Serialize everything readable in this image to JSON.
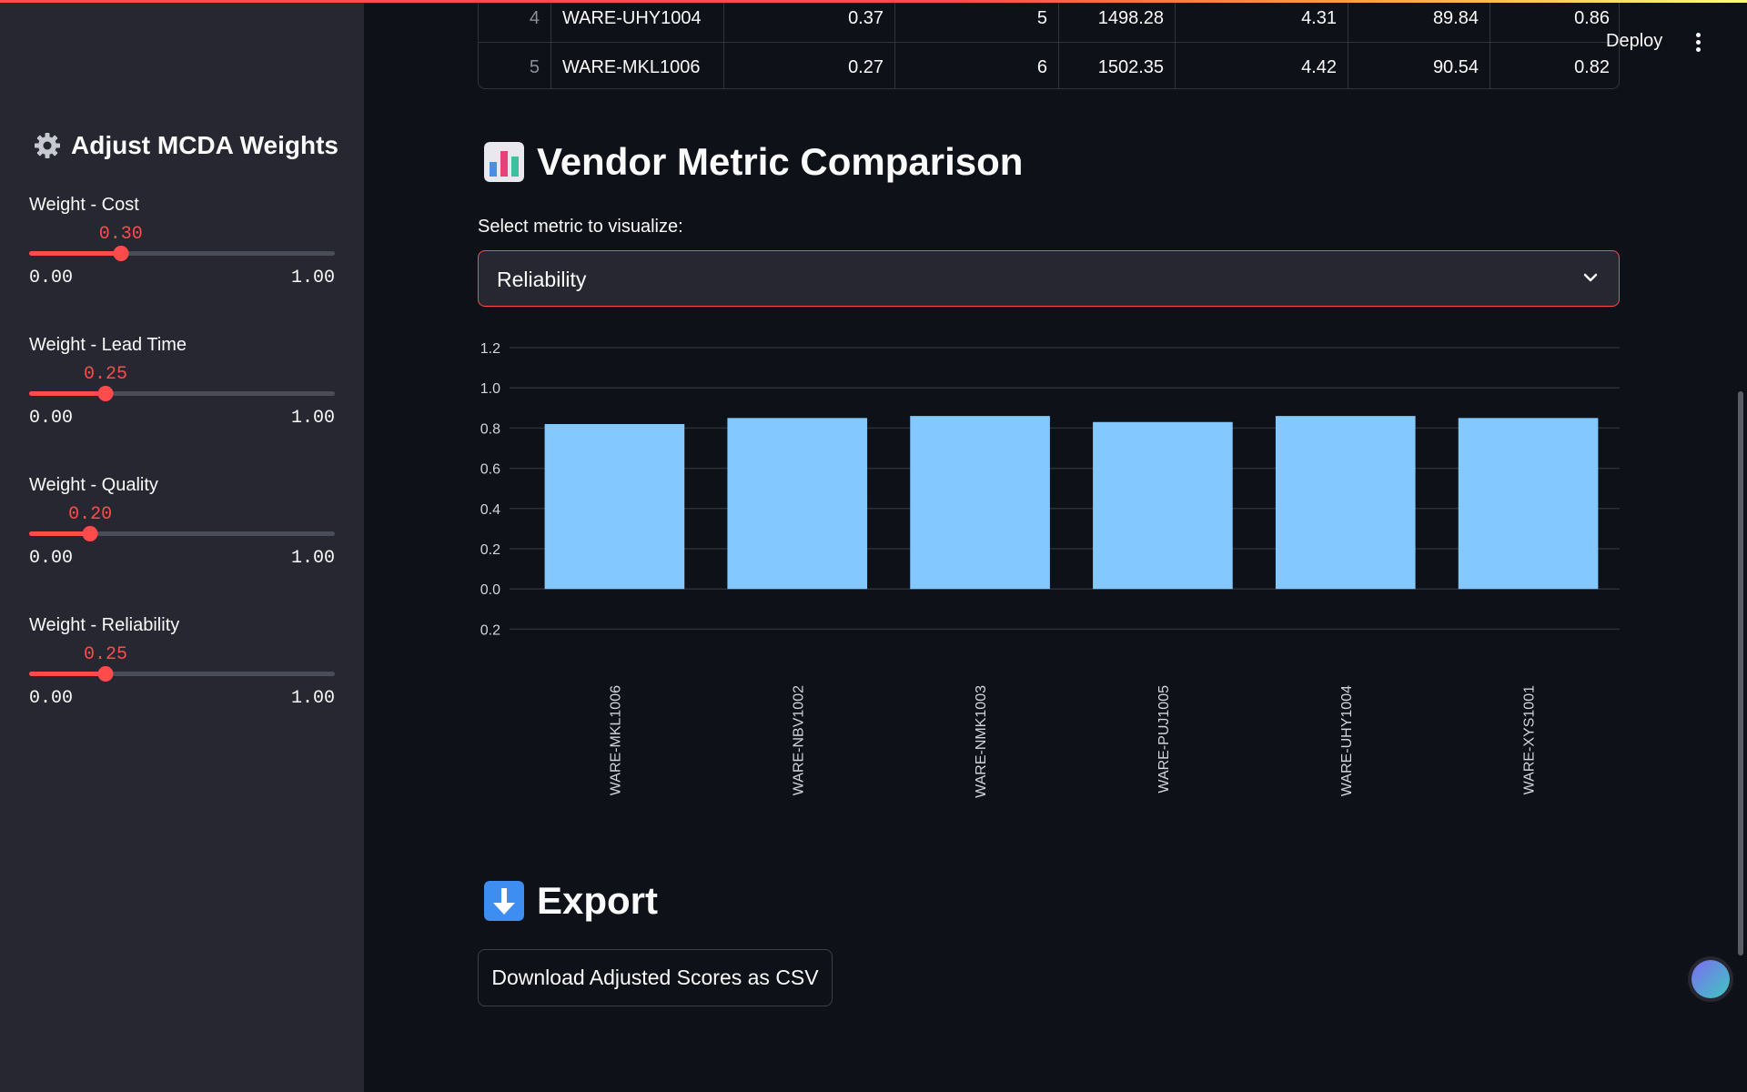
{
  "header": {
    "deploy_label": "Deploy"
  },
  "sidebar": {
    "title": "Adjust MCDA Weights",
    "sliders": [
      {
        "label": "Weight - Cost",
        "value": 0.3,
        "value_text": "0.30",
        "min": "0.00",
        "max": "1.00"
      },
      {
        "label": "Weight - Lead Time",
        "value": 0.25,
        "value_text": "0.25",
        "min": "0.00",
        "max": "1.00"
      },
      {
        "label": "Weight - Quality",
        "value": 0.2,
        "value_text": "0.20",
        "min": "0.00",
        "max": "1.00"
      },
      {
        "label": "Weight - Reliability",
        "value": 0.25,
        "value_text": "0.25",
        "min": "0.00",
        "max": "1.00"
      }
    ]
  },
  "table": {
    "rows": [
      [
        "4",
        "WARE-UHY1004",
        "0.37",
        "5",
        "1498.28",
        "4.31",
        "89.84",
        "0.86"
      ],
      [
        "5",
        "WARE-MKL1006",
        "0.27",
        "6",
        "1502.35",
        "4.42",
        "90.54",
        "0.82"
      ]
    ]
  },
  "comparison": {
    "title": "Vendor Metric Comparison",
    "select_label": "Select metric to visualize:",
    "select_value": "Reliability"
  },
  "chart_data": {
    "type": "bar",
    "categories": [
      "WARE-MKL1006",
      "WARE-NBV1002",
      "WARE-NMK1003",
      "WARE-PUJ1005",
      "WARE-UHY1004",
      "WARE-XYS1001"
    ],
    "values": [
      0.82,
      0.85,
      0.86,
      0.83,
      0.86,
      0.85
    ],
    "ytick_labels": [
      "1.2",
      "1.0",
      "0.8",
      "0.6",
      "0.4",
      "0.2",
      "0.0",
      "0.2"
    ],
    "ylim": [
      -0.2,
      1.2
    ],
    "grid": true,
    "bar_color": "#83c9ff"
  },
  "export": {
    "title": "Export",
    "button_label": "Download Adjusted Scores as CSV"
  },
  "colors": {
    "accent": "#ff4b4b",
    "sidebar_bg": "#262730",
    "main_bg": "#0e1117"
  }
}
